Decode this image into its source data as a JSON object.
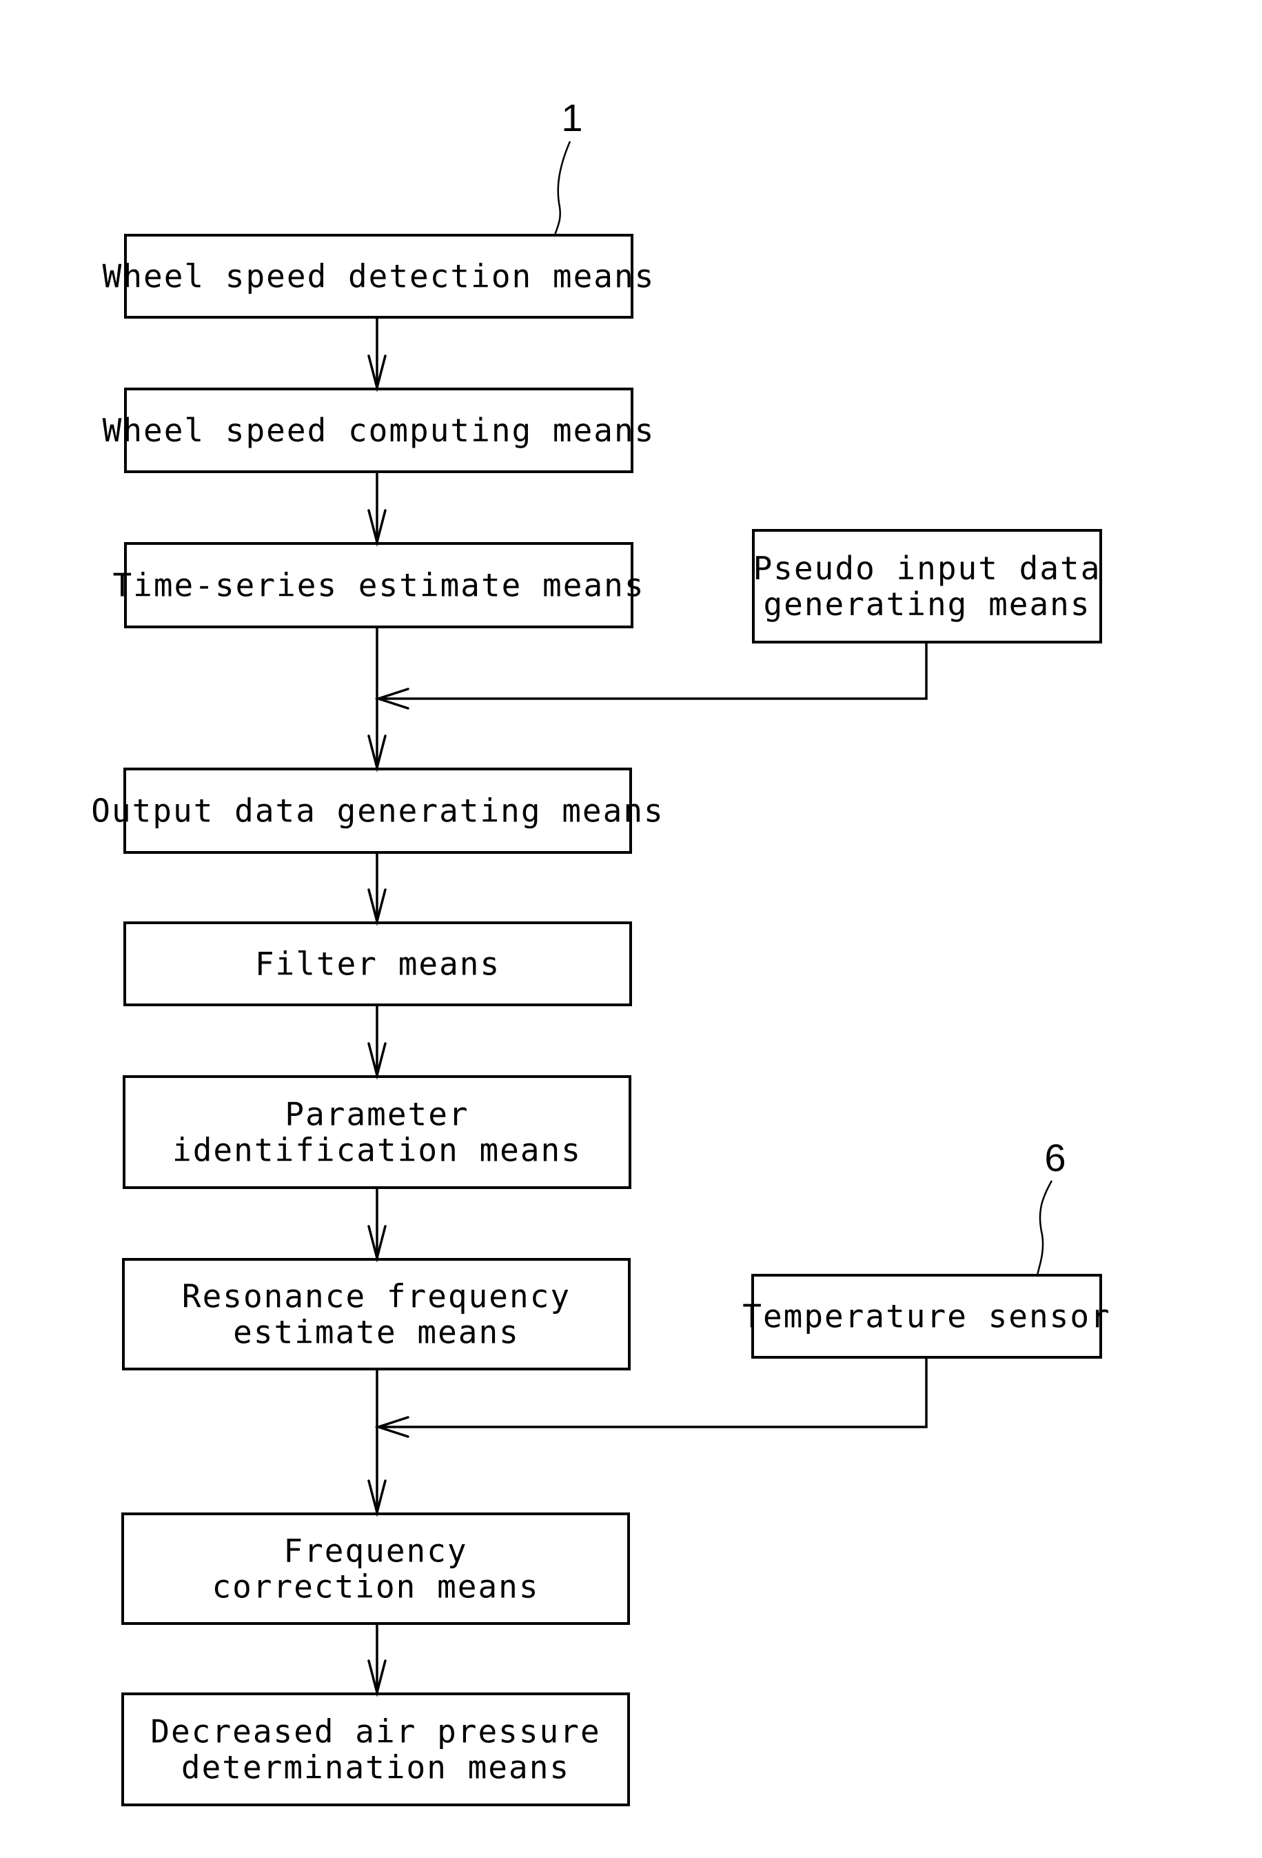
{
  "figure": {
    "reference_numbers": {
      "main_chain": "1",
      "temperature_sensor": "6"
    },
    "main_chain": [
      {
        "id": "wheel-speed-detection",
        "lines": [
          "Wheel speed detection means"
        ]
      },
      {
        "id": "wheel-speed-computing",
        "lines": [
          "Wheel speed computing means"
        ]
      },
      {
        "id": "time-series-estimate",
        "lines": [
          "Time-series estimate means"
        ]
      },
      {
        "id": "output-data-generating",
        "lines": [
          "Output data generating means"
        ]
      },
      {
        "id": "filter",
        "lines": [
          "Filter means"
        ]
      },
      {
        "id": "parameter-identification",
        "lines": [
          "Parameter",
          "identification means"
        ]
      },
      {
        "id": "resonance-frequency-estimate",
        "lines": [
          "Resonance frequency",
          "estimate means"
        ]
      },
      {
        "id": "frequency-correction",
        "lines": [
          "Frequency",
          "correction means"
        ]
      },
      {
        "id": "decreased-air-pressure-determination",
        "lines": [
          "Decreased air pressure",
          "determination means"
        ]
      }
    ],
    "side_inputs": [
      {
        "id": "pseudo-input-data-generating",
        "lines": [
          "Pseudo input data",
          "generating means"
        ],
        "joins_before": "output-data-generating"
      },
      {
        "id": "temperature-sensor",
        "lines": [
          "Temperature sensor"
        ],
        "joins_before": "frequency-correction"
      }
    ]
  }
}
